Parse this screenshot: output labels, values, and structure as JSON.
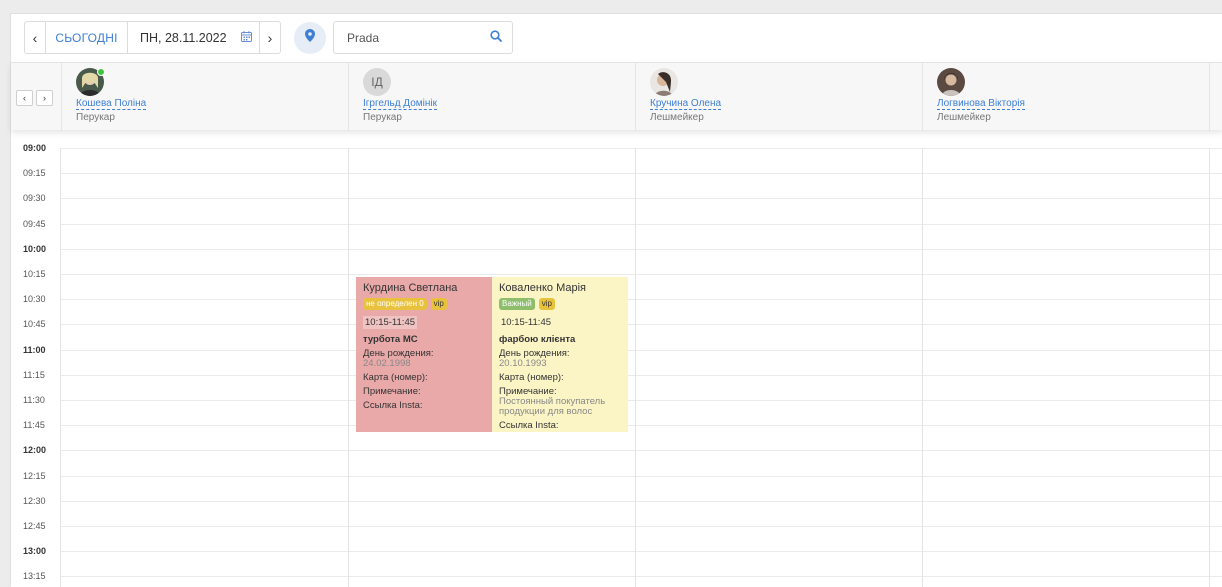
{
  "toolbar": {
    "prev_icon": "‹",
    "today_label": "СЬОГОДНІ",
    "date_value": "ПН, 28.11.2022",
    "calendar_icon": "calendar-icon",
    "next_icon": "›",
    "location_icon": "map-pin-icon",
    "search_value": "Prada",
    "search_icon": "search-icon"
  },
  "staff_nav": {
    "prev": "‹",
    "next": "›"
  },
  "staff": [
    {
      "name": "Кошева Поліна",
      "role": "Перукар",
      "avatar": "photo",
      "online": true
    },
    {
      "name": "Ігргельд Домінік",
      "role": "Перукар",
      "avatar": "initials",
      "initials": "ІД",
      "online": false
    },
    {
      "name": "Кручина Олена",
      "role": "Лешмейкер",
      "avatar": "photo",
      "online": false
    },
    {
      "name": "Логвинова Вікторія",
      "role": "Лешмейкер",
      "avatar": "photo",
      "online": false
    }
  ],
  "times": [
    "09:00",
    "09:15",
    "09:30",
    "09:45",
    "10:00",
    "10:15",
    "10:30",
    "10:45",
    "11:00",
    "11:15",
    "11:30",
    "11:45",
    "12:00",
    "12:15",
    "12:30",
    "12:45",
    "13:00",
    "13:15"
  ],
  "appointments": [
    {
      "client": "Курдина Светлана",
      "tag1": "не определен 0",
      "tag2": "vip",
      "time": "10:15-11:45",
      "service": "турбота МС",
      "birthday_label": "День рождения:",
      "birthday_value": "24.02.1998",
      "card_label": "Карта (номер):",
      "note_label": "Примечание:",
      "insta_label": "Ссылка Insta:",
      "color": "#eaa9a9"
    },
    {
      "client": "Коваленко Марія",
      "tag1": "Важный",
      "tag2": "vip",
      "time": "10:15-11:45",
      "service": "фарбою клієнта",
      "birthday_label": "День рождения:",
      "birthday_value": "20.10.1993",
      "card_label": "Карта (номер):",
      "note_label": "Примечание:",
      "note_value": "Постоянный покупатель продукции для волос",
      "insta_label": "Ссылка Insta:",
      "color": "#fbf5c6"
    }
  ]
}
